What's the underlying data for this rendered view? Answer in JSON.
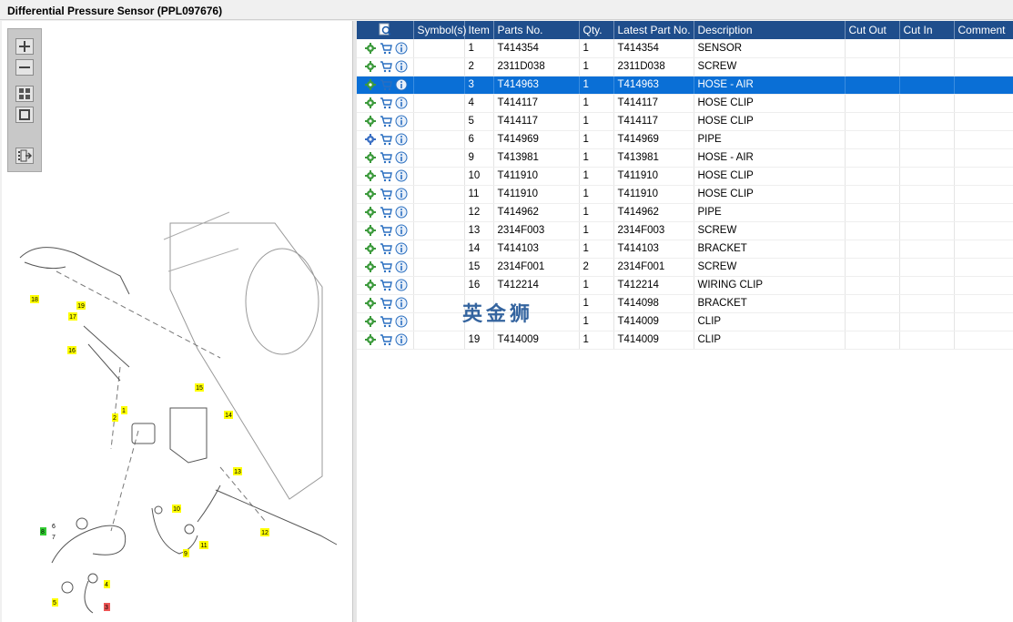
{
  "window": {
    "title": "Differential Pressure Sensor (PPL097676)"
  },
  "toolbar": {
    "buttons": [
      {
        "name": "zoom-in-icon"
      },
      {
        "name": "zoom-out-icon"
      },
      {
        "name": "fit-all-icon"
      },
      {
        "name": "actual-size-icon"
      },
      {
        "name": "export-icon"
      }
    ]
  },
  "table": {
    "columns": [
      "Symbol(s)",
      "Item",
      "Parts No.",
      "Qty.",
      "Latest Part No.",
      "Description",
      "Cut Out",
      "Cut In",
      "Comment"
    ],
    "rows": [
      {
        "item": "1",
        "part": "T414354",
        "qty": "1",
        "latest": "T414354",
        "desc": "SENSOR",
        "cut_out": "",
        "cut_in": "",
        "comment": "",
        "selected": false
      },
      {
        "item": "2",
        "part": "2311D038",
        "qty": "1",
        "latest": "2311D038",
        "desc": "SCREW",
        "cut_out": "",
        "cut_in": "",
        "comment": "",
        "selected": false
      },
      {
        "item": "3",
        "part": "T414963",
        "qty": "1",
        "latest": "T414963",
        "desc": "HOSE - AIR",
        "cut_out": "",
        "cut_in": "",
        "comment": "",
        "selected": true
      },
      {
        "item": "4",
        "part": "T414117",
        "qty": "1",
        "latest": "T414117",
        "desc": "HOSE CLIP",
        "cut_out": "",
        "cut_in": "",
        "comment": "",
        "selected": false
      },
      {
        "item": "5",
        "part": "T414117",
        "qty": "1",
        "latest": "T414117",
        "desc": "HOSE CLIP",
        "cut_out": "",
        "cut_in": "",
        "comment": "",
        "selected": false
      },
      {
        "item": "6",
        "part": "T414969",
        "qty": "1",
        "latest": "T414969",
        "desc": "PIPE",
        "cut_out": "",
        "cut_in": "",
        "comment": "",
        "selected": false
      },
      {
        "item": "9",
        "part": "T413981",
        "qty": "1",
        "latest": "T413981",
        "desc": "HOSE - AIR",
        "cut_out": "",
        "cut_in": "",
        "comment": "",
        "selected": false
      },
      {
        "item": "10",
        "part": "T411910",
        "qty": "1",
        "latest": "T411910",
        "desc": "HOSE CLIP",
        "cut_out": "",
        "cut_in": "",
        "comment": "",
        "selected": false
      },
      {
        "item": "11",
        "part": "T411910",
        "qty": "1",
        "latest": "T411910",
        "desc": "HOSE CLIP",
        "cut_out": "",
        "cut_in": "",
        "comment": "",
        "selected": false
      },
      {
        "item": "12",
        "part": "T414962",
        "qty": "1",
        "latest": "T414962",
        "desc": "PIPE",
        "cut_out": "",
        "cut_in": "",
        "comment": "",
        "selected": false
      },
      {
        "item": "13",
        "part": "2314F003",
        "qty": "1",
        "latest": "2314F003",
        "desc": "SCREW",
        "cut_out": "",
        "cut_in": "",
        "comment": "",
        "selected": false
      },
      {
        "item": "14",
        "part": "T414103",
        "qty": "1",
        "latest": "T414103",
        "desc": "BRACKET",
        "cut_out": "",
        "cut_in": "",
        "comment": "",
        "selected": false
      },
      {
        "item": "15",
        "part": "2314F001",
        "qty": "2",
        "latest": "2314F001",
        "desc": "SCREW",
        "cut_out": "",
        "cut_in": "",
        "comment": "",
        "selected": false
      },
      {
        "item": "16",
        "part": "T412214",
        "qty": "1",
        "latest": "T412214",
        "desc": "WIRING CLIP",
        "cut_out": "",
        "cut_in": "",
        "comment": "",
        "selected": false
      },
      {
        "item": "",
        "part": "",
        "qty": "1",
        "latest": "T414098",
        "desc": "BRACKET",
        "cut_out": "",
        "cut_in": "",
        "comment": "",
        "selected": false
      },
      {
        "item": "",
        "part": "",
        "qty": "1",
        "latest": "T414009",
        "desc": "CLIP",
        "cut_out": "",
        "cut_in": "",
        "comment": "",
        "selected": false
      },
      {
        "item": "19",
        "part": "T414009",
        "qty": "1",
        "latest": "T414009",
        "desc": "CLIP",
        "cut_out": "",
        "cut_in": "",
        "comment": "",
        "selected": false
      }
    ]
  },
  "watermark": "英金狮",
  "diagram": {
    "callouts": [
      "18",
      "19",
      "17",
      "16",
      "15",
      "14",
      "1",
      "2",
      "13",
      "10",
      "12",
      "8",
      "6",
      "7",
      "9",
      "11",
      "4",
      "5",
      "3"
    ],
    "colors": {
      "yellow": "#ffff00",
      "green": "#33cc33",
      "red": "#ee5555"
    }
  },
  "colors": {
    "header": "#1f4e8c",
    "selected": "#0a6fd6"
  }
}
